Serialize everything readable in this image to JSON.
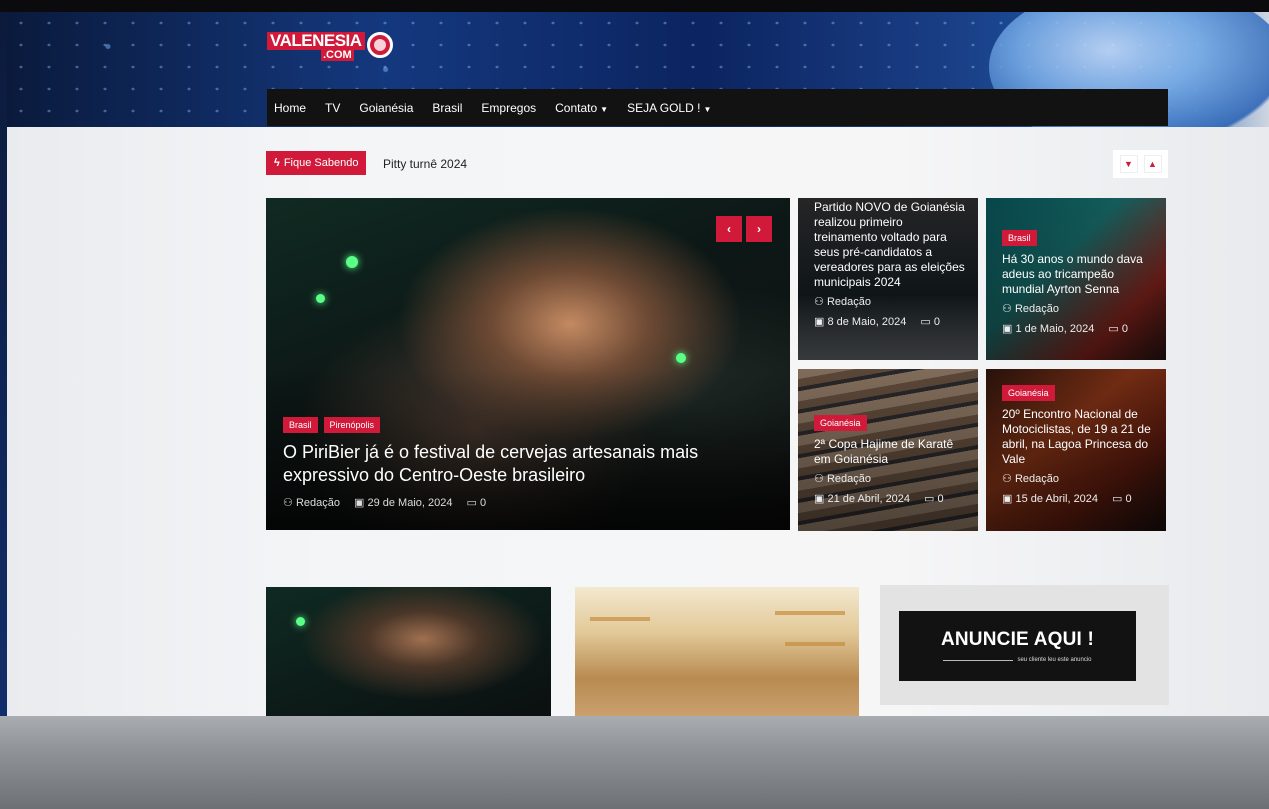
{
  "site": {
    "logo_text": "VALENESIA",
    "logo_com": ".COM"
  },
  "nav": {
    "items": [
      {
        "label": "Home",
        "caret": false
      },
      {
        "label": "TV",
        "caret": false
      },
      {
        "label": "Goianésia",
        "caret": false
      },
      {
        "label": "Brasil",
        "caret": false
      },
      {
        "label": "Empregos",
        "caret": false
      },
      {
        "label": "Contato",
        "caret": true
      },
      {
        "label": "SEJA GOLD !",
        "caret": true
      }
    ]
  },
  "ticker": {
    "badge": "Fique Sabendo",
    "text": "Pitty turnê 2024"
  },
  "feature": {
    "tags": [
      "Brasil",
      "Pirenópolis"
    ],
    "title": "O PiriBier já é o festival de cervejas artesanais mais expressivo do Centro-Oeste brasileiro",
    "author": "Redação",
    "date": "29 de Maio, 2024",
    "comments": "0"
  },
  "cards": [
    {
      "tag": "",
      "title": "Partido NOVO de Goianésia realizou primeiro treinamento voltado para seus pré-candidatos a vereadores para as eleições municipais 2024",
      "author": "Redação",
      "date": "8 de Maio, 2024",
      "comments": "0"
    },
    {
      "tag": "Brasil",
      "title": "Há 30 anos o mundo dava adeus ao tricampeão mundial Ayrton Senna",
      "author": "Redação",
      "date": "1 de Maio, 2024",
      "comments": "0"
    },
    {
      "tag": "Goianésia",
      "title": "2ª Copa Hajime de Karatê em Goianésia",
      "author": "Redação",
      "date": "21 de Abril, 2024",
      "comments": "0"
    },
    {
      "tag": "Goianésia",
      "title": "20º Encontro Nacional de Motociclistas, de 19 a 21 de abril, na Lagoa Princesa do Vale",
      "author": "Redação",
      "date": "15 de Abril, 2024",
      "comments": "0"
    }
  ],
  "ad": {
    "title": "ANUNCIE AQUI !",
    "subtitle": "seu cliente leu este anuncio"
  },
  "icons": {
    "prev": "‹",
    "next": "›",
    "down": "⌄",
    "up": "⌃",
    "bolt": "ϟ",
    "user": "⚇",
    "calendar": "▣",
    "comment": "▭"
  },
  "colors": {
    "accent": "#d11a3a",
    "navbar": "#121212"
  }
}
